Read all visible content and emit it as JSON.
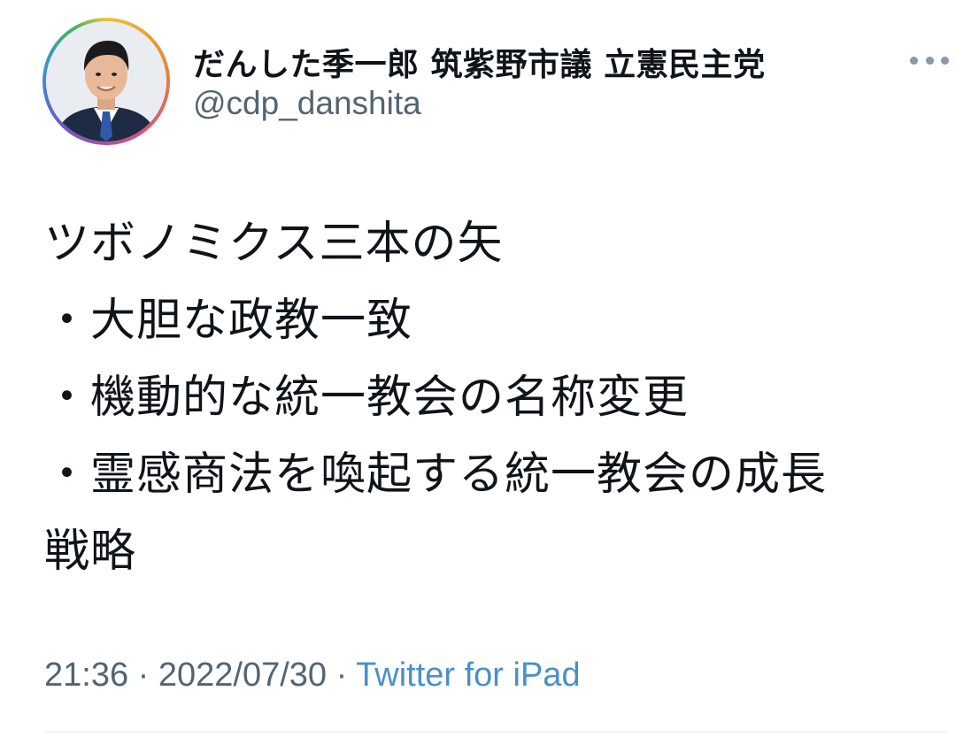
{
  "user": {
    "display_name": "だんした季一郎 筑紫野市議 立憲民主党",
    "handle": "@cdp_danshita",
    "avatar_icon": "profile-photo",
    "ring_colors": [
      "#e9c63a",
      "#e98a34",
      "#d84d7d",
      "#6e55c8",
      "#3b8fd6",
      "#47b45c"
    ]
  },
  "more_icon": "ellipsis-icon",
  "tweet": {
    "lines": [
      "ツボノミクス三本の矢",
      "・大胆な政教一致",
      "・機動的な統一教会の名称変更",
      "・霊感商法を喚起する統一教会の成長",
      "戦略"
    ]
  },
  "meta": {
    "time": "21:36",
    "separator": "·",
    "date": "2022/07/30",
    "source": "Twitter for iPad"
  },
  "colors": {
    "text": "#0f1419",
    "secondary": "#536471",
    "link": "#4a90c9"
  }
}
